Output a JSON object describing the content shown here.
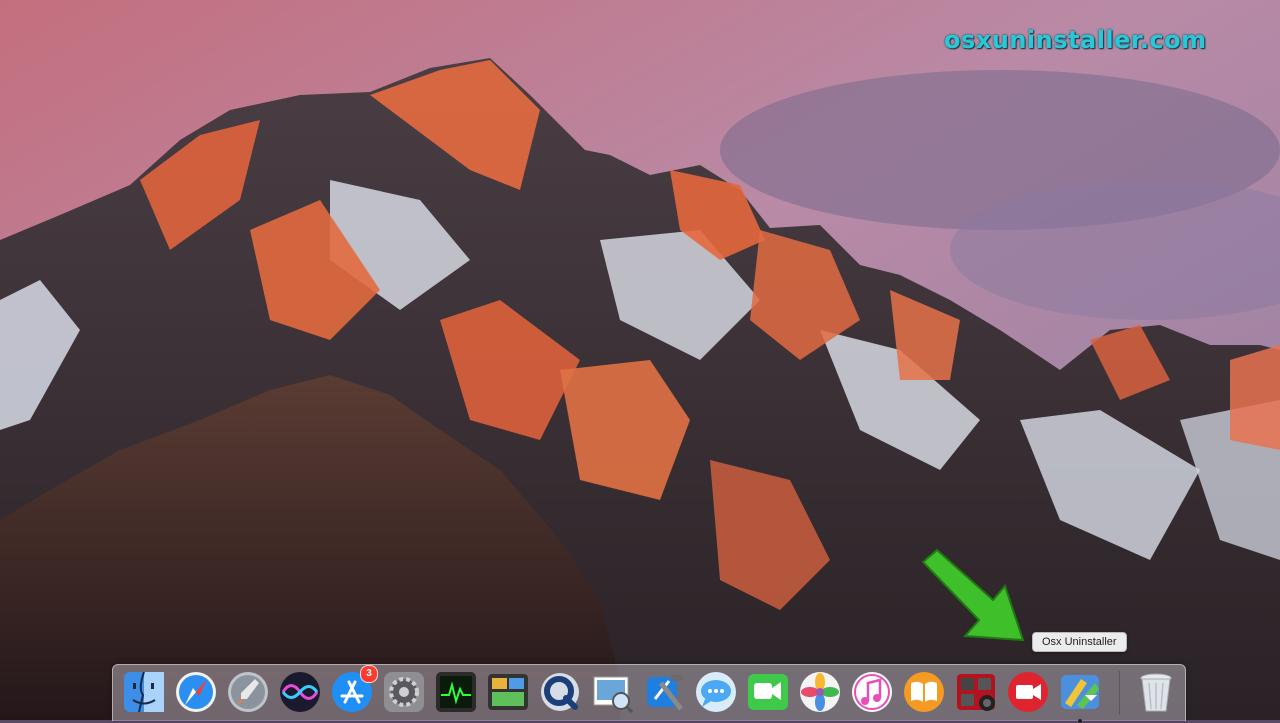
{
  "watermark": "osxuninstaller.com",
  "tooltip": "Osx Uninstaller",
  "dock": {
    "items": [
      {
        "name": "Finder",
        "icon": "finder-icon"
      },
      {
        "name": "Safari",
        "icon": "safari-icon"
      },
      {
        "name": "Launchpad",
        "icon": "launchpad-icon"
      },
      {
        "name": "Siri",
        "icon": "siri-icon"
      },
      {
        "name": "App Store",
        "icon": "app-store-icon",
        "badge": "3"
      },
      {
        "name": "System Preferences",
        "icon": "system-preferences-icon"
      },
      {
        "name": "Activity Monitor",
        "icon": "activity-monitor-icon"
      },
      {
        "name": "Mission Control",
        "icon": "mission-control-icon"
      },
      {
        "name": "QuickTime Player",
        "icon": "quicktime-icon"
      },
      {
        "name": "Preview",
        "icon": "preview-icon"
      },
      {
        "name": "Xcode",
        "icon": "xcode-icon"
      },
      {
        "name": "Messages",
        "icon": "messages-icon"
      },
      {
        "name": "FaceTime",
        "icon": "facetime-icon"
      },
      {
        "name": "Photos",
        "icon": "photos-icon"
      },
      {
        "name": "iTunes",
        "icon": "itunes-icon"
      },
      {
        "name": "iBooks",
        "icon": "ibooks-icon"
      },
      {
        "name": "Photo Booth",
        "icon": "photo-booth-icon"
      },
      {
        "name": "Video Recorder",
        "icon": "video-recorder-icon"
      },
      {
        "name": "Osx Uninstaller",
        "icon": "osx-uninstaller-icon"
      },
      {
        "name": "Trash",
        "icon": "trash-icon"
      }
    ]
  },
  "colors": {
    "watermark": "#29c7d8",
    "sky_top": "#c9788a",
    "sky_right": "#9a86a6",
    "peak_lit": "#e2653e",
    "arrow": "#3fbf2a"
  }
}
